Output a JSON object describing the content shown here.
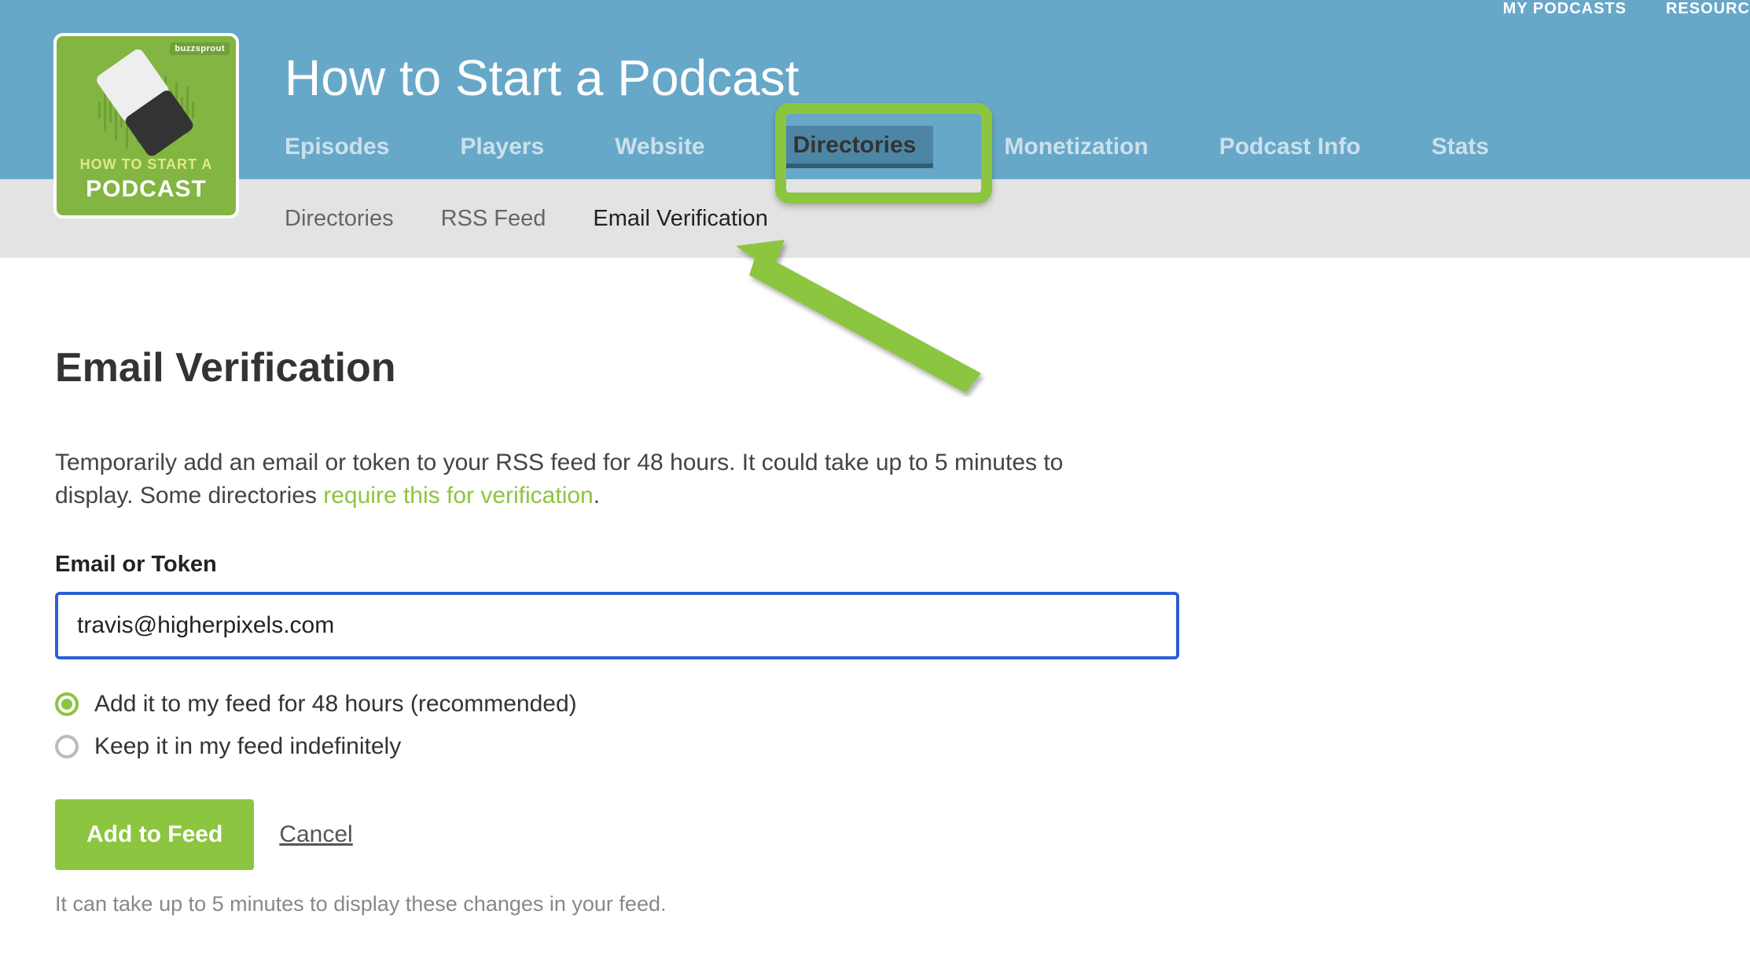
{
  "topnav": {
    "my_podcasts": "MY PODCASTS",
    "resources": "RESOURC"
  },
  "logo": {
    "badge": "buzzsprout",
    "line1": "HOW TO START A",
    "line2": "PODCAST"
  },
  "podcast_title": "How to Start a Podcast",
  "mainnav": {
    "episodes": "Episodes",
    "players": "Players",
    "website": "Website",
    "directories": "Directories",
    "monetization": "Monetization",
    "podcast_info": "Podcast Info",
    "stats": "Stats"
  },
  "subnav": {
    "directories": "Directories",
    "rss_feed": "RSS Feed",
    "email_verification": "Email Verification"
  },
  "page": {
    "heading": "Email Verification",
    "desc_part1": "Temporarily add an email or token to your RSS feed for 48 hours. It could take up to 5 minutes to display. Some directories ",
    "desc_link": "require this for verification",
    "desc_part2": ".",
    "field_label": "Email or Token",
    "field_value": "travis@higherpixels.com",
    "radio1": "Add it to my feed for 48 hours (recommended)",
    "radio2": "Keep it in my feed indefinitely",
    "submit": "Add to Feed",
    "cancel": "Cancel",
    "footnote": "It can take up to 5 minutes to display these changes in your feed."
  }
}
